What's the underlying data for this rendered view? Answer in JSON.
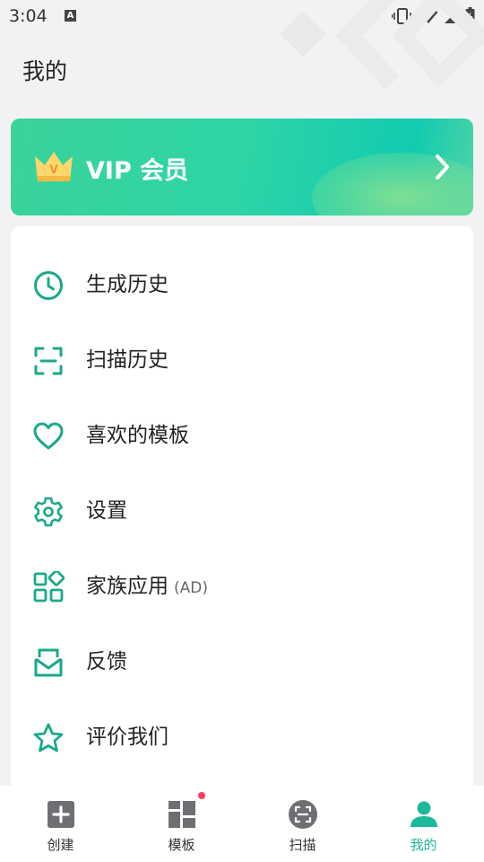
{
  "status_bar": {
    "time": "3:04",
    "badge": "A"
  },
  "page": {
    "title": "我的"
  },
  "vip": {
    "label": "VIP 会员",
    "crown_letter": "V"
  },
  "menu": [
    {
      "label": "生成历史",
      "icon": "clock-icon"
    },
    {
      "label": "扫描历史",
      "icon": "scan-frame-icon"
    },
    {
      "label": "喜欢的模板",
      "icon": "heart-icon"
    },
    {
      "label": "设置",
      "icon": "gear-icon"
    },
    {
      "label": "家族应用",
      "tag": "(AD)",
      "icon": "apps-grid-icon"
    },
    {
      "label": "反馈",
      "icon": "mail-icon"
    },
    {
      "label": "评价我们",
      "icon": "star-icon"
    }
  ],
  "tabs": [
    {
      "label": "创建",
      "icon": "plus-square-icon"
    },
    {
      "label": "模板",
      "icon": "template-grid-icon",
      "has_badge": true
    },
    {
      "label": "扫描",
      "icon": "scan-circle-icon"
    },
    {
      "label": "我的",
      "icon": "person-icon",
      "active": true
    }
  ],
  "colors": {
    "accent": "#1bb99a",
    "icon_green": "#1aa98a",
    "vip_start": "#3ad39a",
    "vip_end": "#12cbb0",
    "badge_red": "#ff3b5c"
  }
}
